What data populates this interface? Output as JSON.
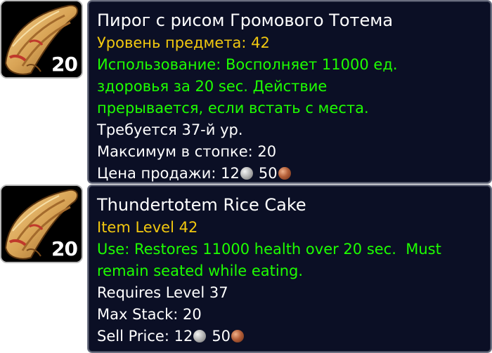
{
  "item_ru": {
    "stack_count": "20",
    "name": "Пирог с рисом Громового Тотема",
    "item_level": "Уровень предмета: 42",
    "use_text": "Использование: Восполняет 11000 ед. здоровья за 20 sec. Действие прерывается, если встать с места.",
    "requires": "Требуется 37-й ур.",
    "max_stack": "Максимум в стопке: 20",
    "sell_label": "Цена продажи: ",
    "sell_silver": "12",
    "sell_copper": "50",
    "icon": "rice-cake-icon"
  },
  "item_en": {
    "stack_count": "20",
    "name": "Thundertotem Rice Cake",
    "item_level": "Item Level 42",
    "use_text": "Use: Restores 11000 health over 20 sec.  Must remain seated while eating.",
    "requires": "Requires Level 37",
    "max_stack": "Max Stack: 20",
    "sell_label": "Sell Price: ",
    "sell_silver": "12",
    "sell_copper": "50",
    "icon": "rice-cake-icon"
  },
  "colors": {
    "tooltip_bg": "#0b0f25",
    "title": "#ffffff",
    "item_level": "#f2c80f",
    "use_effect": "#1eff00",
    "body_text": "#ffffff"
  }
}
